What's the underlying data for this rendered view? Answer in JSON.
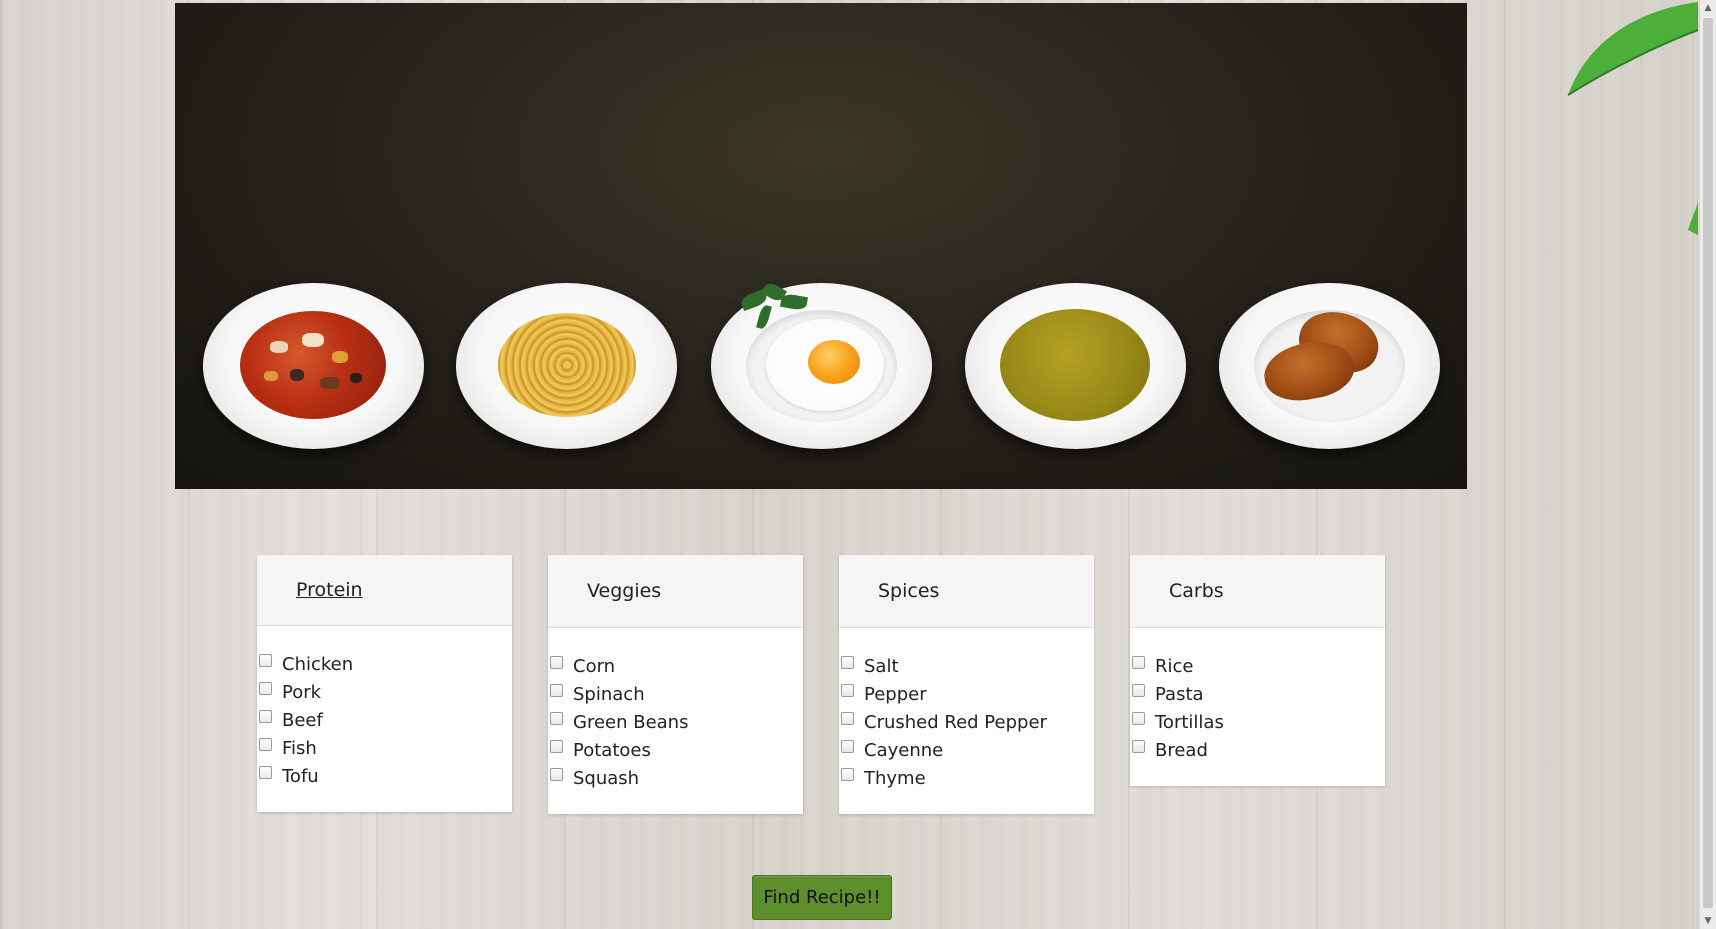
{
  "hero": {
    "plates": [
      {
        "food": "vegetable-soup"
      },
      {
        "food": "spaghetti"
      },
      {
        "food": "fried-egg"
      },
      {
        "food": "green-soup"
      },
      {
        "food": "croissants"
      }
    ]
  },
  "categories": [
    {
      "title": "Protein",
      "items": [
        "Chicken",
        "Pork",
        "Beef",
        "Fish",
        "Tofu"
      ]
    },
    {
      "title": "Veggies",
      "items": [
        "Corn",
        "Spinach",
        "Green Beans",
        "Potatoes",
        "Squash"
      ]
    },
    {
      "title": "Spices",
      "items": [
        "Salt",
        "Pepper",
        "Crushed Red Pepper",
        "Cayenne",
        "Thyme"
      ]
    },
    {
      "title": "Carbs",
      "items": [
        "Rice",
        "Pasta",
        "Tortillas",
        "Bread"
      ]
    }
  ],
  "find_button": {
    "label": "Find Recipe!!"
  },
  "colors": {
    "button_bg": "#5f8e2c",
    "hero_bg": "#24221a"
  }
}
